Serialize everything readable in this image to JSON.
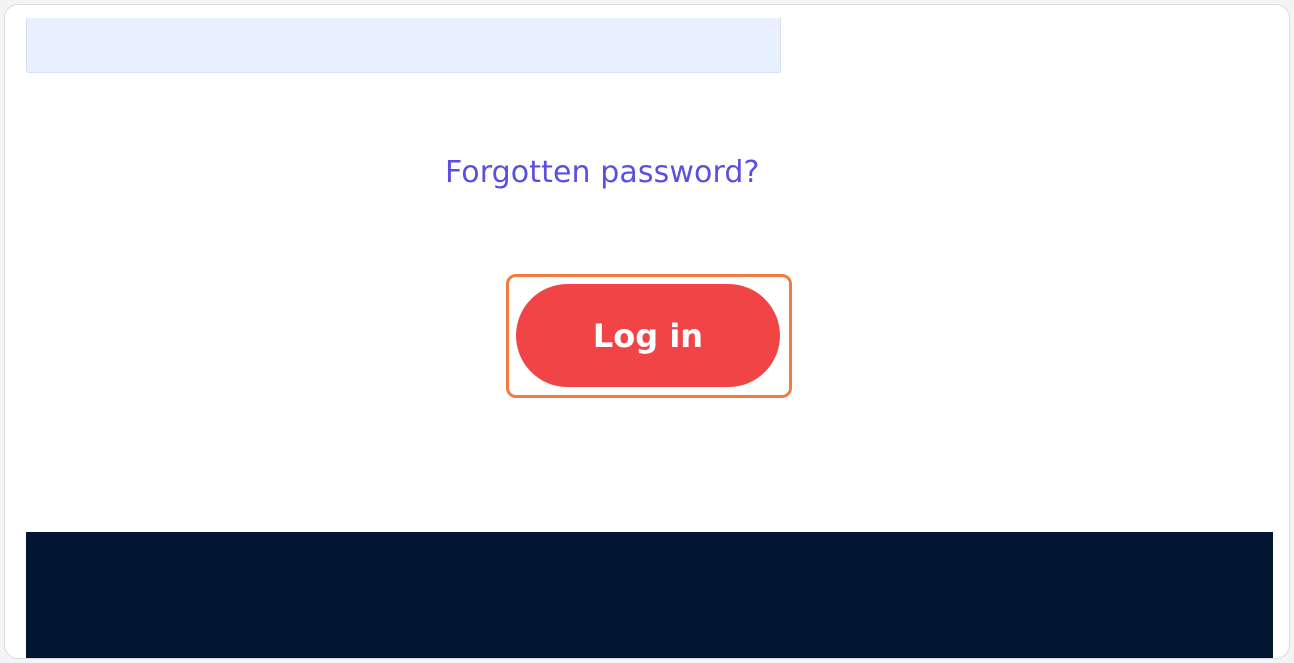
{
  "login_form": {
    "password_value": "",
    "forgot_password_label": "Forgotten password?",
    "login_button_label": "Log in"
  },
  "colors": {
    "link": "#5b4fe0",
    "button": "#f04446",
    "highlight": "#f47a42",
    "footer": "#021633",
    "field": "#e8effd"
  }
}
